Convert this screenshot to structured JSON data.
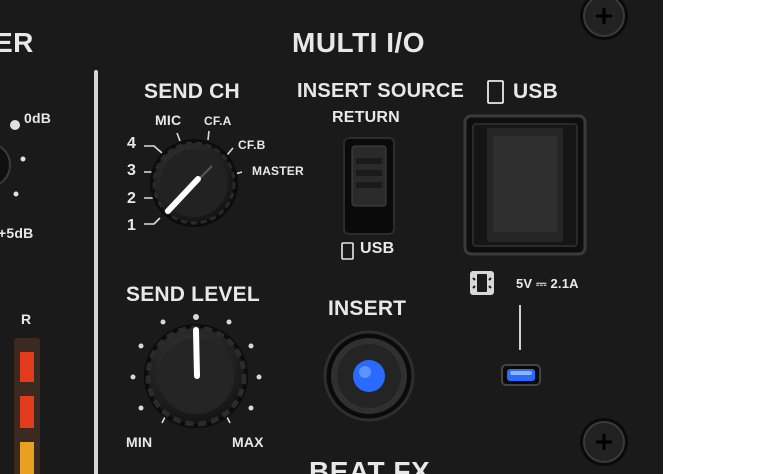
{
  "panel": {
    "section_title": "MULTI I/O",
    "left_partial_title": "ER",
    "left_labels": {
      "zero_db": "0dB",
      "plus5_db": "+5dB",
      "meter_r": "R"
    },
    "send_ch": {
      "label": "SEND CH",
      "positions": [
        "1",
        "2",
        "3",
        "4",
        "MIC",
        "CF.A",
        "CF.B",
        "MASTER"
      ],
      "selected": "1"
    },
    "insert_source": {
      "label": "INSERT SOURCE",
      "top_position": "RETURN",
      "bottom_position": "USB",
      "selected": "USB"
    },
    "usb": {
      "label": "USB",
      "power_spec": "5V ⎓ 2.1A"
    },
    "send_level": {
      "label": "SEND LEVEL",
      "min_label": "MIN",
      "max_label": "MAX",
      "level": 0.5
    },
    "insert": {
      "label": "INSERT",
      "active": true
    },
    "bottom_partial_title": "BEAT FX",
    "colors": {
      "panel": "#1a1a1a",
      "text": "#e8e8e8",
      "led_blue": "#2a6bff",
      "meter_red": "#e23b1e",
      "meter_orange": "#e8a020"
    }
  }
}
